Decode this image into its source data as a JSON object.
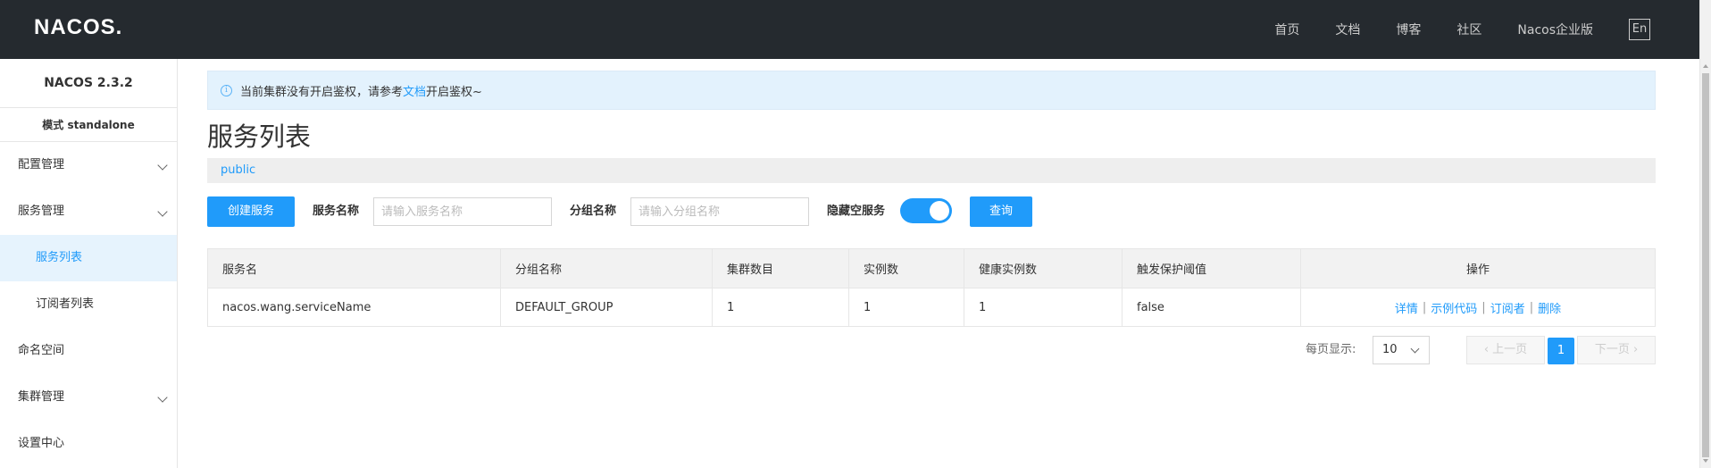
{
  "header": {
    "logo_text": "NACOS.",
    "nav": [
      "首页",
      "文档",
      "博客",
      "社区",
      "Nacos企业版"
    ],
    "lang_button": "En"
  },
  "sidebar": {
    "version": "NACOS 2.3.2",
    "mode": "模式 standalone",
    "items": [
      {
        "label": "配置管理"
      },
      {
        "label": "服务管理"
      },
      {
        "label": "服务列表"
      },
      {
        "label": "订阅者列表"
      },
      {
        "label": "命名空间"
      },
      {
        "label": "集群管理"
      },
      {
        "label": "设置中心"
      }
    ]
  },
  "notice": {
    "prefix": "当前集群没有开启鉴权，请参考",
    "link": "文档",
    "suffix": "开启鉴权~"
  },
  "page": {
    "title": "服务列表",
    "namespace": "public"
  },
  "filters": {
    "create_button": "创建服务",
    "service_name_label": "服务名称",
    "service_name_placeholder": "请输入服务名称",
    "group_name_label": "分组名称",
    "group_name_placeholder": "请输入分组名称",
    "hide_empty_label": "隐藏空服务",
    "hide_empty_on": true,
    "query_button": "查询"
  },
  "table": {
    "headers": [
      "服务名",
      "分组名称",
      "集群数目",
      "实例数",
      "健康实例数",
      "触发保护阈值",
      "操作"
    ],
    "rows": [
      [
        "nacos.wang.serviceName",
        "DEFAULT_GROUP",
        "1",
        "1",
        "1",
        "false"
      ]
    ],
    "ops": [
      "详情",
      "示例代码",
      "订阅者",
      "删除"
    ],
    "op_separator": "|"
  },
  "pagination": {
    "per_page_label": "每页显示:",
    "per_page_value": "10",
    "prev": "上一页",
    "next": "下一页",
    "current_page": "1"
  },
  "colors": {
    "accent": "#209bfa",
    "topbar": "#252a2f"
  }
}
